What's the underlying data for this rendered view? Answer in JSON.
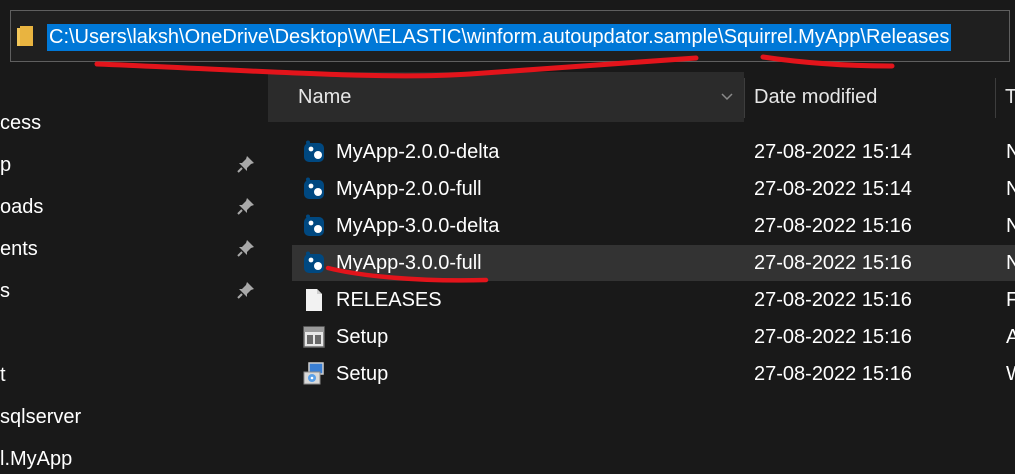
{
  "address_bar": {
    "path": "C:\\Users\\laksh\\OneDrive\\Desktop\\W\\ELASTIC\\winform.autoupdator.sample\\Squirrel.MyApp\\Releases"
  },
  "nav": {
    "items": [
      {
        "label": "cess",
        "pinned": false
      },
      {
        "label": "p",
        "pinned": true
      },
      {
        "label": "oads",
        "pinned": true
      },
      {
        "label": "ents",
        "pinned": true
      },
      {
        "label": "s",
        "pinned": true
      },
      {
        "label": "",
        "pinned": false
      },
      {
        "label": "t",
        "pinned": false
      },
      {
        "label": "sqlserver",
        "pinned": false
      },
      {
        "label": "l.MyApp",
        "pinned": false
      }
    ]
  },
  "columns": {
    "name": "Name",
    "date_modified": "Date modified",
    "type": "T"
  },
  "files": [
    {
      "name": "MyApp-2.0.0-delta",
      "date": "27-08-2022 15:14",
      "type": "N",
      "icon": "nuget-package-icon",
      "selected": false
    },
    {
      "name": "MyApp-2.0.0-full",
      "date": "27-08-2022 15:14",
      "type": "N",
      "icon": "nuget-package-icon",
      "selected": false
    },
    {
      "name": "MyApp-3.0.0-delta",
      "date": "27-08-2022 15:16",
      "type": "N",
      "icon": "nuget-package-icon",
      "selected": false
    },
    {
      "name": "MyApp-3.0.0-full",
      "date": "27-08-2022 15:16",
      "type": "N",
      "icon": "nuget-package-icon",
      "selected": true
    },
    {
      "name": "RELEASES",
      "date": "27-08-2022 15:16",
      "type": "F",
      "icon": "file-icon",
      "selected": false
    },
    {
      "name": "Setup",
      "date": "27-08-2022 15:16",
      "type": "A",
      "icon": "application-icon",
      "selected": false
    },
    {
      "name": "Setup",
      "date": "27-08-2022 15:16",
      "type": "W",
      "icon": "installer-icon",
      "selected": false
    }
  ],
  "colors": {
    "background": "#191919",
    "selection": "#0078d7",
    "annotation": "#e3141b"
  }
}
